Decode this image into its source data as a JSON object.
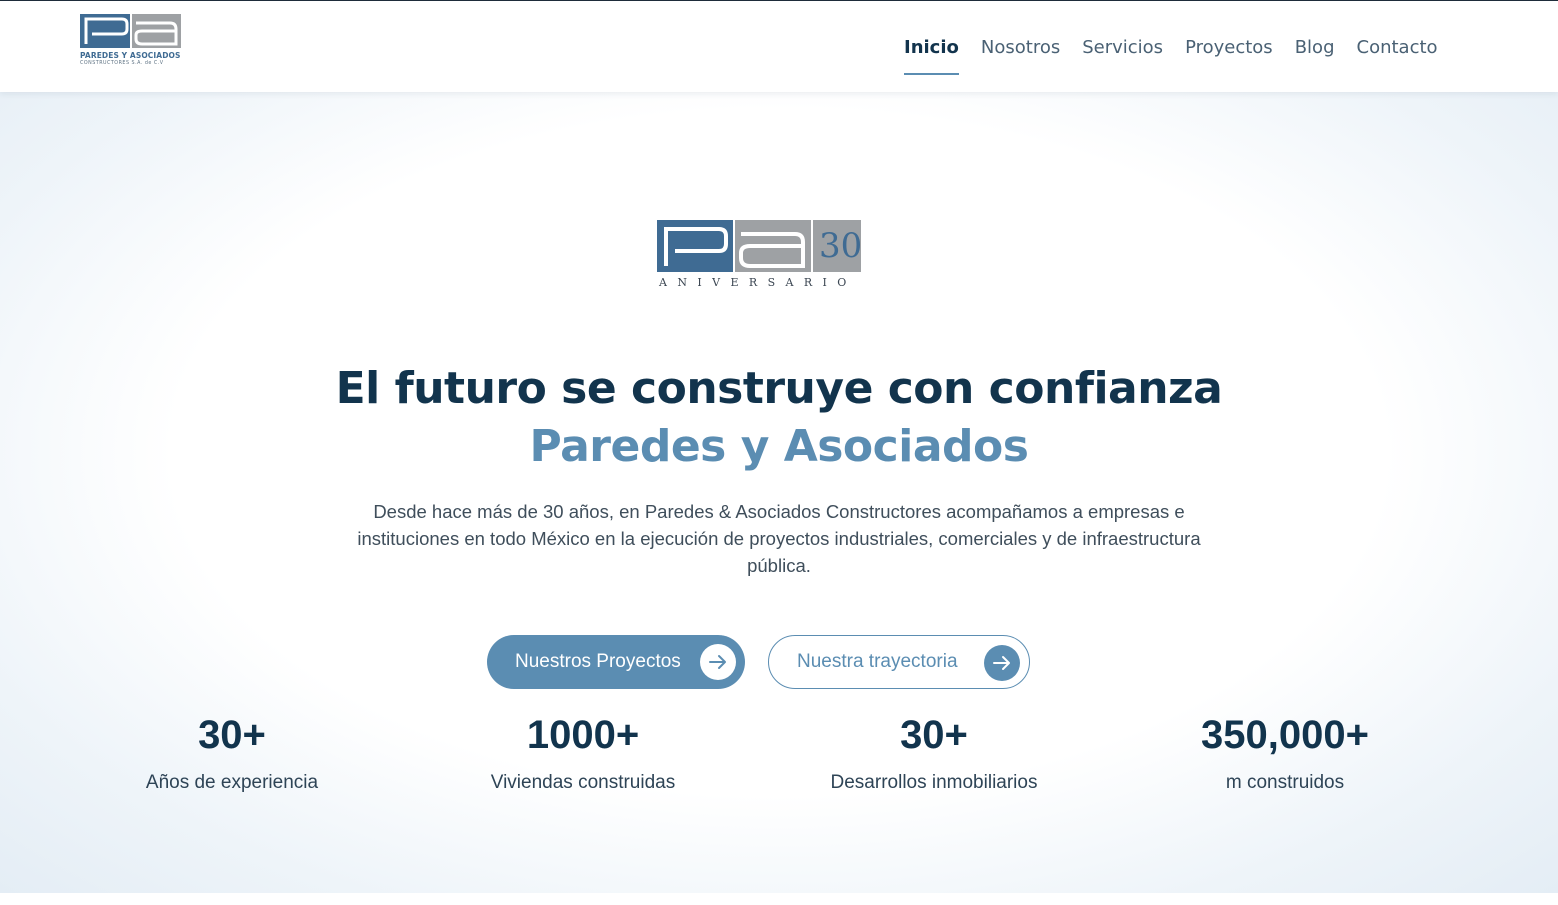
{
  "header": {
    "brand_name": "PAREDES Y ASOCIADOS",
    "brand_sub": "CONSTRUCTORES S.A. de C.V"
  },
  "nav": [
    {
      "label": "Inicio",
      "active": true
    },
    {
      "label": "Nosotros"
    },
    {
      "label": "Servicios"
    },
    {
      "label": "Proyectos"
    },
    {
      "label": "Blog"
    },
    {
      "label": "Contacto"
    }
  ],
  "hero": {
    "anniversary_number": "30",
    "anniversary_word": "ANIVERSARIO",
    "title": "El futuro se construye con confianza",
    "subtitle": "Paredes y Asociados",
    "description": "Desde hace más de 30 años, en Paredes & Asociados Constructores acompañamos a empresas e instituciones en todo México en la ejecución de proyectos industriales, comerciales y de infraestructura pública.",
    "primary_button": "Nuestros Proyectos",
    "secondary_button": "Nuestra trayectoria"
  },
  "stats": [
    {
      "value": "30+",
      "label": "Años de experiencia"
    },
    {
      "value": "1000+",
      "label": "Viviendas construidas"
    },
    {
      "value": "30+",
      "label": "Desarrollos inmobiliarios"
    },
    {
      "value": "350,000+",
      "label": "m construidos"
    }
  ],
  "colors": {
    "brand_blue": "#3f6b93",
    "accent": "#5b8db2",
    "navy": "#12344d",
    "gray": "#9ea1a4"
  }
}
